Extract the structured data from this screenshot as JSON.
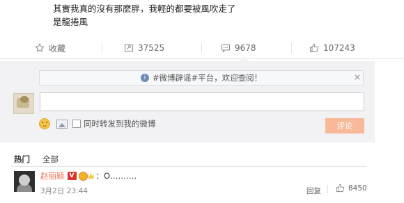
{
  "post": {
    "line1": "其實我真的沒有那麼胖，我輕的都要被風吹走了",
    "line2": "是龍捲風"
  },
  "actions": {
    "favorite_label": "收藏",
    "repost_count": "37525",
    "comment_count": "9678",
    "like_count": "107243"
  },
  "notice": {
    "text": "#微博辟谣#平台，欢迎查阅！",
    "info_icon": "i",
    "close_icon": "×"
  },
  "composer": {
    "input_value": "",
    "forward_label": "同时转发到我的微博",
    "submit_label": "评论"
  },
  "filters": {
    "hot": "热门",
    "all": "全部"
  },
  "comments": [
    {
      "user": "赵丽颖",
      "verified_badge": "V",
      "text": "：O……….",
      "time": "3月2日 23:44",
      "reply_label": "回复",
      "likes": "8450"
    }
  ],
  "colors": {
    "accent": "#eb7350",
    "submit_button": "#f8b89a",
    "panel_bg": "#f2f2f5",
    "verified": "#d9352b"
  }
}
